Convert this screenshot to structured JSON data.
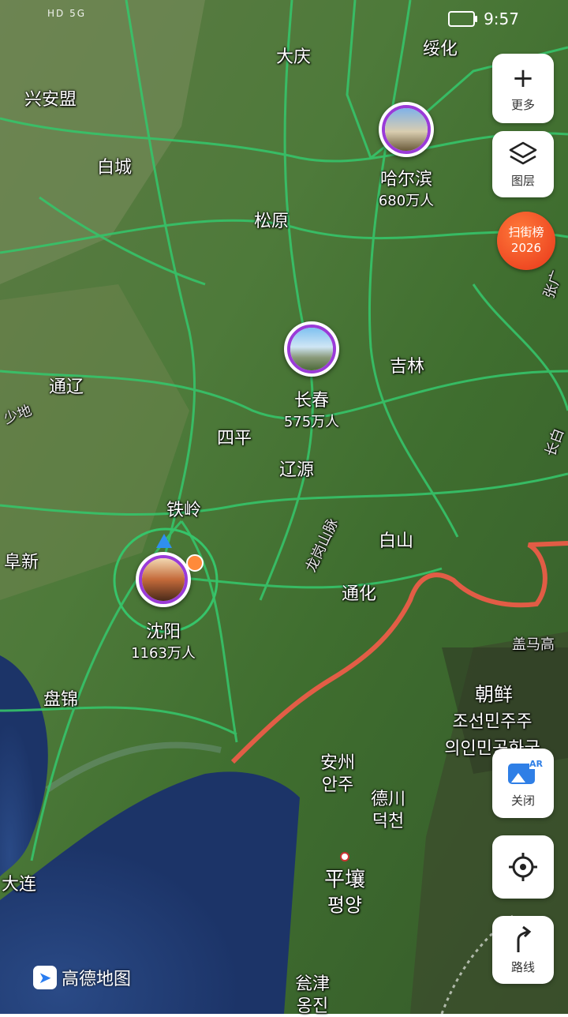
{
  "status_bar": {
    "signal": "HD 5G",
    "time": "9:57"
  },
  "cities": [
    {
      "id": "daqing",
      "name": "大庆"
    },
    {
      "id": "suihua",
      "name": "绥化"
    },
    {
      "id": "xinganmeng",
      "name": "兴安盟"
    },
    {
      "id": "baicheng",
      "name": "白城"
    },
    {
      "id": "songyuan",
      "name": "松原"
    },
    {
      "id": "jilin",
      "name": "吉林"
    },
    {
      "id": "tongliao",
      "name": "通辽"
    },
    {
      "id": "siping",
      "name": "四平"
    },
    {
      "id": "liaoyuan",
      "name": "辽源"
    },
    {
      "id": "tieling",
      "name": "铁岭"
    },
    {
      "id": "baishan",
      "name": "白山"
    },
    {
      "id": "fuxin",
      "name": "阜新"
    },
    {
      "id": "tonghua",
      "name": "通化"
    },
    {
      "id": "panjin",
      "name": "盘锦"
    },
    {
      "id": "dalian",
      "name": "大连"
    }
  ],
  "featured": {
    "harbin": {
      "name": "哈尔滨",
      "population": "680万人"
    },
    "changchun": {
      "name": "长春",
      "population": "575万人"
    },
    "shenyang": {
      "name": "沈阳",
      "population": "1163万人"
    }
  },
  "north_korea": {
    "country_cn": "朝鲜",
    "country_kr_1": "조선민주주",
    "country_kr_2": "의인민공화국",
    "anju_cn": "安州",
    "anju_kr": "안주",
    "deokcheon_cn": "德川",
    "deokcheon_kr": "덕천",
    "pyongyang_cn": "平壤",
    "pyongyang_kr": "평양",
    "ongjin_cn": "瓮津",
    "ongjin_kr": "옹진"
  },
  "region_labels": {
    "sandy": "少地",
    "longgang": "龙岗山脉",
    "gaima": "盖马高",
    "zhangguang": "张广",
    "changbai": "长白"
  },
  "controls": {
    "more_label": "更多",
    "layers_label": "图层",
    "ar_label": "关闭",
    "ar_badge": "AR",
    "route_label": "路线"
  },
  "scan_badge": {
    "line1": "扫街榜",
    "line2": "2026"
  },
  "logo": {
    "text": "高德地图"
  },
  "colors": {
    "road": "#36c46a",
    "border": "#ff5a4a",
    "pin_ring": "#9a3bd8",
    "scan_badge": "#ee4a22"
  }
}
